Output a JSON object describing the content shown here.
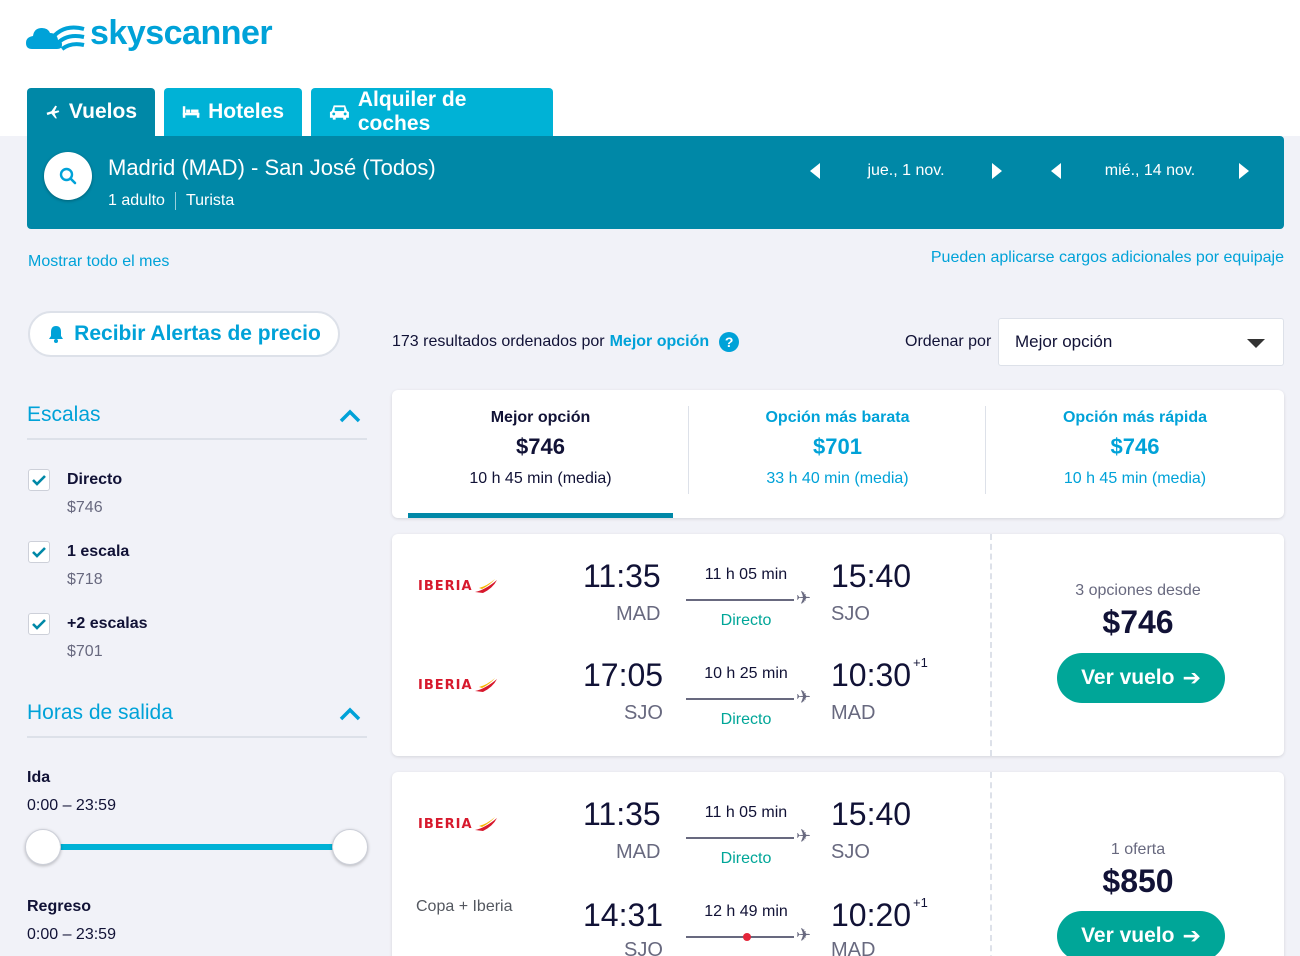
{
  "brand": {
    "name": "skyscanner",
    "color": "#00a2d8"
  },
  "tabs": [
    {
      "label": "Vuelos",
      "icon": "plane-icon",
      "active": true
    },
    {
      "label": "Hoteles",
      "icon": "bed-icon",
      "active": false
    },
    {
      "label": "Alquiler de coches",
      "icon": "car-icon",
      "active": false
    }
  ],
  "search": {
    "route": "Madrid (MAD) - San José (Todos)",
    "travellers": "1 adulto",
    "cabin": "Turista",
    "depart_date": "jue., 1 nov.",
    "return_date": "mié., 14 nov."
  },
  "links": {
    "show_month": "Mostrar todo el mes",
    "baggage": "Pueden aplicarse cargos adicionales por equipaje"
  },
  "price_alert_label": "Recibir Alertas de precio",
  "filters": {
    "stops": {
      "title": "Escalas",
      "options": [
        {
          "label": "Directo",
          "price": "$746",
          "checked": true
        },
        {
          "label": "1 escala",
          "price": "$718",
          "checked": true
        },
        {
          "label": "+2 escalas",
          "price": "$701",
          "checked": true
        }
      ]
    },
    "departure": {
      "title": "Horas de salida",
      "outbound_label": "Ida",
      "outbound_range": "0:00 – 23:59",
      "return_label": "Regreso",
      "return_range": "0:00 – 23:59"
    }
  },
  "results": {
    "count_text": "173 resultados ordenados por",
    "sort_highlight": "Mejor opción",
    "help": "?",
    "sort_label": "Ordenar por",
    "sort_value": "Mejor opción"
  },
  "sort_tabs": [
    {
      "title": "Mejor opción",
      "price": "$746",
      "duration": "10 h 45 min (media)",
      "selected": true
    },
    {
      "title": "Opción más barata",
      "price": "$701",
      "duration": "33 h 40 min (media)",
      "selected": false
    },
    {
      "title": "Opción más rápida",
      "price": "$746",
      "duration": "10 h 45 min (media)",
      "selected": false
    }
  ],
  "cards": [
    {
      "legs": [
        {
          "airline": "IBERIA",
          "dep_time": "11:35",
          "dep_apt": "MAD",
          "duration": "11 h 05 min",
          "stops": "Directo",
          "arr_time": "15:40",
          "arr_apt": "SJO",
          "plus_day": ""
        },
        {
          "airline": "IBERIA",
          "dep_time": "17:05",
          "dep_apt": "SJO",
          "duration": "10 h 25 min",
          "stops": "Directo",
          "arr_time": "10:30",
          "arr_apt": "MAD",
          "plus_day": "+1"
        }
      ],
      "offer_text": "3 opciones desde",
      "price": "$746",
      "button": "Ver vuelo",
      "button_arrow": "➔"
    },
    {
      "legs": [
        {
          "airline": "IBERIA",
          "dep_time": "11:35",
          "dep_apt": "MAD",
          "duration": "11 h 05 min",
          "stops": "Directo",
          "arr_time": "15:40",
          "arr_apt": "SJO",
          "plus_day": ""
        },
        {
          "airline": "Copa + Iberia",
          "dep_time": "14:31",
          "dep_apt": "SJO",
          "duration": "12 h 49 min",
          "stops": "",
          "arr_time": "10:20",
          "arr_apt": "MAD",
          "plus_day": "+1"
        }
      ],
      "offer_text": "1 oferta",
      "price": "$850",
      "button": "Ver vuelo",
      "button_arrow": "➔"
    }
  ]
}
